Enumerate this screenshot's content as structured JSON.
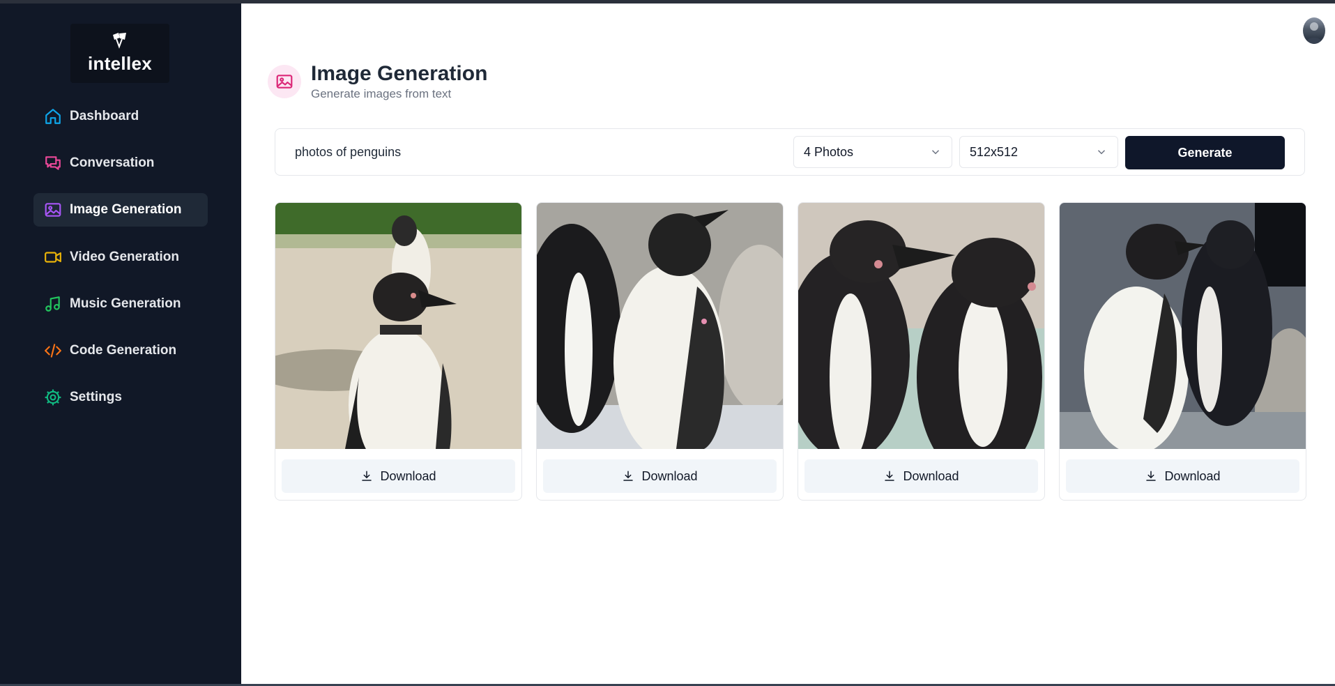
{
  "app": {
    "logo_text": "intellex"
  },
  "sidebar": {
    "items": [
      {
        "label": "Dashboard",
        "icon": "home-icon",
        "color": "#0ea5e9"
      },
      {
        "label": "Conversation",
        "icon": "chat-icon",
        "color": "#ec4899"
      },
      {
        "label": "Image Generation",
        "icon": "image-icon",
        "color": "#a855f7",
        "active": true
      },
      {
        "label": "Video Generation",
        "icon": "video-icon",
        "color": "#eab308"
      },
      {
        "label": "Music Generation",
        "icon": "music-icon",
        "color": "#22c55e"
      },
      {
        "label": "Code Generation",
        "icon": "code-icon",
        "color": "#f97316"
      },
      {
        "label": "Settings",
        "icon": "settings-icon",
        "color": "#10b981"
      }
    ]
  },
  "header": {
    "title": "Image Generation",
    "subtitle": "Generate images from text",
    "icon": "image-icon",
    "icon_color": "#db2777"
  },
  "form": {
    "prompt_value": "photos of penguins",
    "amount_selected": "4 Photos",
    "resolution_selected": "512x512",
    "generate_label": "Generate"
  },
  "results": [
    {
      "alt": "penguin photo 1",
      "download_label": "Download"
    },
    {
      "alt": "penguin photo 2",
      "download_label": "Download"
    },
    {
      "alt": "penguin photo 3",
      "download_label": "Download"
    },
    {
      "alt": "penguin photo 4",
      "download_label": "Download"
    }
  ],
  "colors": {
    "sidebar_bg": "#111827",
    "primary_button": "#0f172a",
    "download_bg": "#f1f5f9"
  }
}
